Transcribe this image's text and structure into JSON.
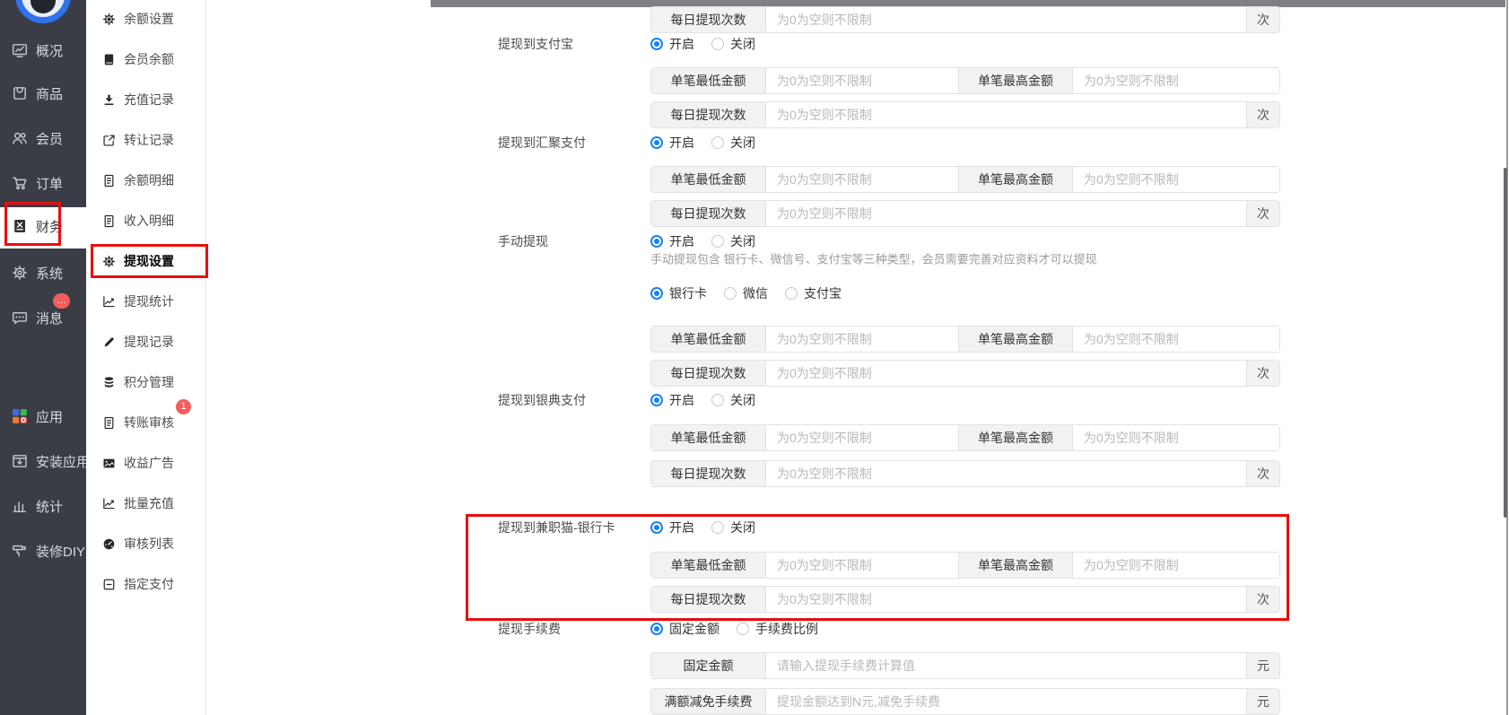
{
  "colors": {
    "accent": "#1681fa",
    "annotation": "#e80e0e",
    "badge": "#f25d5d",
    "sidebar_bg": "#3a3d46",
    "topbar": "#7e8085"
  },
  "sidebar": {
    "items": [
      {
        "label": "概况",
        "icon": "overview-icon"
      },
      {
        "label": "商品",
        "icon": "goods-icon"
      },
      {
        "label": "会员",
        "icon": "member-icon"
      },
      {
        "label": "订单",
        "icon": "order-icon"
      },
      {
        "label": "财务",
        "icon": "finance-icon",
        "active": true,
        "annotated": true
      },
      {
        "label": "系统",
        "icon": "system-icon"
      },
      {
        "label": "消息",
        "icon": "message-icon",
        "badge": "…"
      },
      {
        "label": "应用",
        "icon": "apps-icon"
      },
      {
        "label": "安装应用",
        "icon": "install-icon"
      },
      {
        "label": "统计",
        "icon": "stats-icon"
      },
      {
        "label": "装修DIY",
        "icon": "diy-icon"
      }
    ]
  },
  "submenu": {
    "items": [
      {
        "label": "余额设置",
        "icon": "gear-icon"
      },
      {
        "label": "会员余额",
        "icon": "book-icon"
      },
      {
        "label": "充值记录",
        "icon": "download-icon"
      },
      {
        "label": "转让记录",
        "icon": "external-link-icon"
      },
      {
        "label": "余额明细",
        "icon": "doc-icon"
      },
      {
        "label": "收入明细",
        "icon": "doc-icon"
      },
      {
        "label": "提现设置",
        "icon": "gear-icon",
        "active": true,
        "annotated": true
      },
      {
        "label": "提现统计",
        "icon": "chart-line-icon"
      },
      {
        "label": "提现记录",
        "icon": "pencil-icon"
      },
      {
        "label": "积分管理",
        "icon": "database-icon"
      },
      {
        "label": "转账审核",
        "icon": "doc-icon",
        "badge": "1"
      },
      {
        "label": "收益广告",
        "icon": "image-icon"
      },
      {
        "label": "批量充值",
        "icon": "chart-line-icon"
      },
      {
        "label": "审核列表",
        "icon": "dashboard-icon"
      },
      {
        "label": "指定支付",
        "icon": "minus-square-icon"
      }
    ]
  },
  "form": {
    "common": {
      "on": "开启",
      "off": "关闭",
      "unlimited_placeholder": "为0为空则不限制",
      "min_label": "单笔最低金额",
      "max_label": "单笔最高金额",
      "daily_label": "每日提现次数",
      "times_suffix": "次",
      "yuan_suffix": "元"
    },
    "top_partial_row": {
      "label": "每日提现次数",
      "placeholder": "为0为空则不限制",
      "suffix": "次"
    },
    "sections": [
      {
        "label": "提现到支付宝",
        "radio": {
          "options": [
            "开启",
            "关闭"
          ],
          "selected": 0
        },
        "rows": [
          {
            "kind": "minmax"
          },
          {
            "kind": "daily"
          }
        ]
      },
      {
        "label": "提现到汇聚支付",
        "radio": {
          "options": [
            "开启",
            "关闭"
          ],
          "selected": 0
        },
        "rows": [
          {
            "kind": "minmax"
          },
          {
            "kind": "daily"
          }
        ]
      },
      {
        "label": "手动提现",
        "radio": {
          "options": [
            "开启",
            "关闭"
          ],
          "selected": 0
        },
        "help": "手动提现包含 银行卡、微信号、支付宝等三种类型，会员需要完善对应资料才可以提现",
        "type_radio": {
          "options": [
            "银行卡",
            "微信",
            "支付宝"
          ],
          "selected": 0
        },
        "rows": [
          {
            "kind": "minmax"
          },
          {
            "kind": "daily"
          }
        ]
      },
      {
        "label": "提现到银典支付",
        "radio": {
          "options": [
            "开启",
            "关闭"
          ],
          "selected": 0
        },
        "rows": [
          {
            "kind": "minmax"
          },
          {
            "kind": "daily"
          }
        ]
      },
      {
        "label": "提现到兼职猫-银行卡",
        "annotated": true,
        "radio": {
          "options": [
            "开启",
            "关闭"
          ],
          "selected": 0
        },
        "rows": [
          {
            "kind": "minmax"
          },
          {
            "kind": "daily"
          }
        ]
      },
      {
        "label": "提现手续费",
        "radio": {
          "options": [
            "固定金额",
            "手续费比例"
          ],
          "selected": 0
        },
        "rows": [
          {
            "kind": "single",
            "label": "固定金额",
            "placeholder": "请输入提现手续费计算值",
            "suffix": "元"
          },
          {
            "kind": "single",
            "label": "满额减免手续费",
            "placeholder": "提现金额达到N元,减免手续费",
            "suffix": "元"
          }
        ]
      }
    ]
  }
}
